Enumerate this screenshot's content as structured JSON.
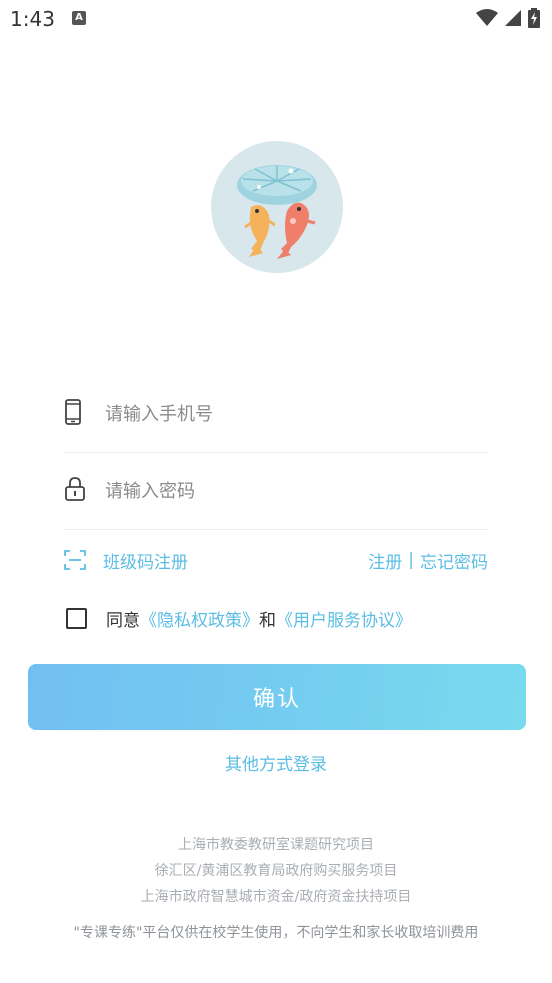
{
  "status_bar": {
    "time": "1:43",
    "notification_icon": "font-a-icon",
    "wifi_icon": "wifi-icon",
    "signal_icon": "signal-icon",
    "battery_icon": "battery-charging-icon"
  },
  "logo": {
    "icon": "lotus-leaf-koi-fish-logo"
  },
  "form": {
    "phone": {
      "placeholder": "请输入手机号",
      "value": "",
      "icon": "mobile-phone-icon"
    },
    "password": {
      "placeholder": "请输入密码",
      "value": "",
      "icon": "lock-icon"
    }
  },
  "links": {
    "class_code_register": "班级码注册",
    "class_code_icon": "scan-icon",
    "register": "注册",
    "separator": "|",
    "forgot_password": "忘记密码"
  },
  "agreement": {
    "checked": false,
    "prefix": "同意",
    "privacy_policy": "《隐私权政策》",
    "and": "和",
    "user_agreement": "《用户服务协议》"
  },
  "confirm_label": "确认",
  "other_login_label": "其他方式登录",
  "footer": {
    "line1": "上海市教委教研室课题研究项目",
    "line2": "徐汇区/黄浦区教育局政府购买服务项目",
    "line3": "上海市政府智慧城市资金/政府资金扶持项目",
    "note": "\"专课专练\"平台仅供在校学生使用，不向学生和家长收取培训费用"
  },
  "colors": {
    "accent": "#5bbde4",
    "button_start": "#65b9f1",
    "button_end": "#6dd7ec",
    "logo_bg": "#d8e7ec"
  }
}
